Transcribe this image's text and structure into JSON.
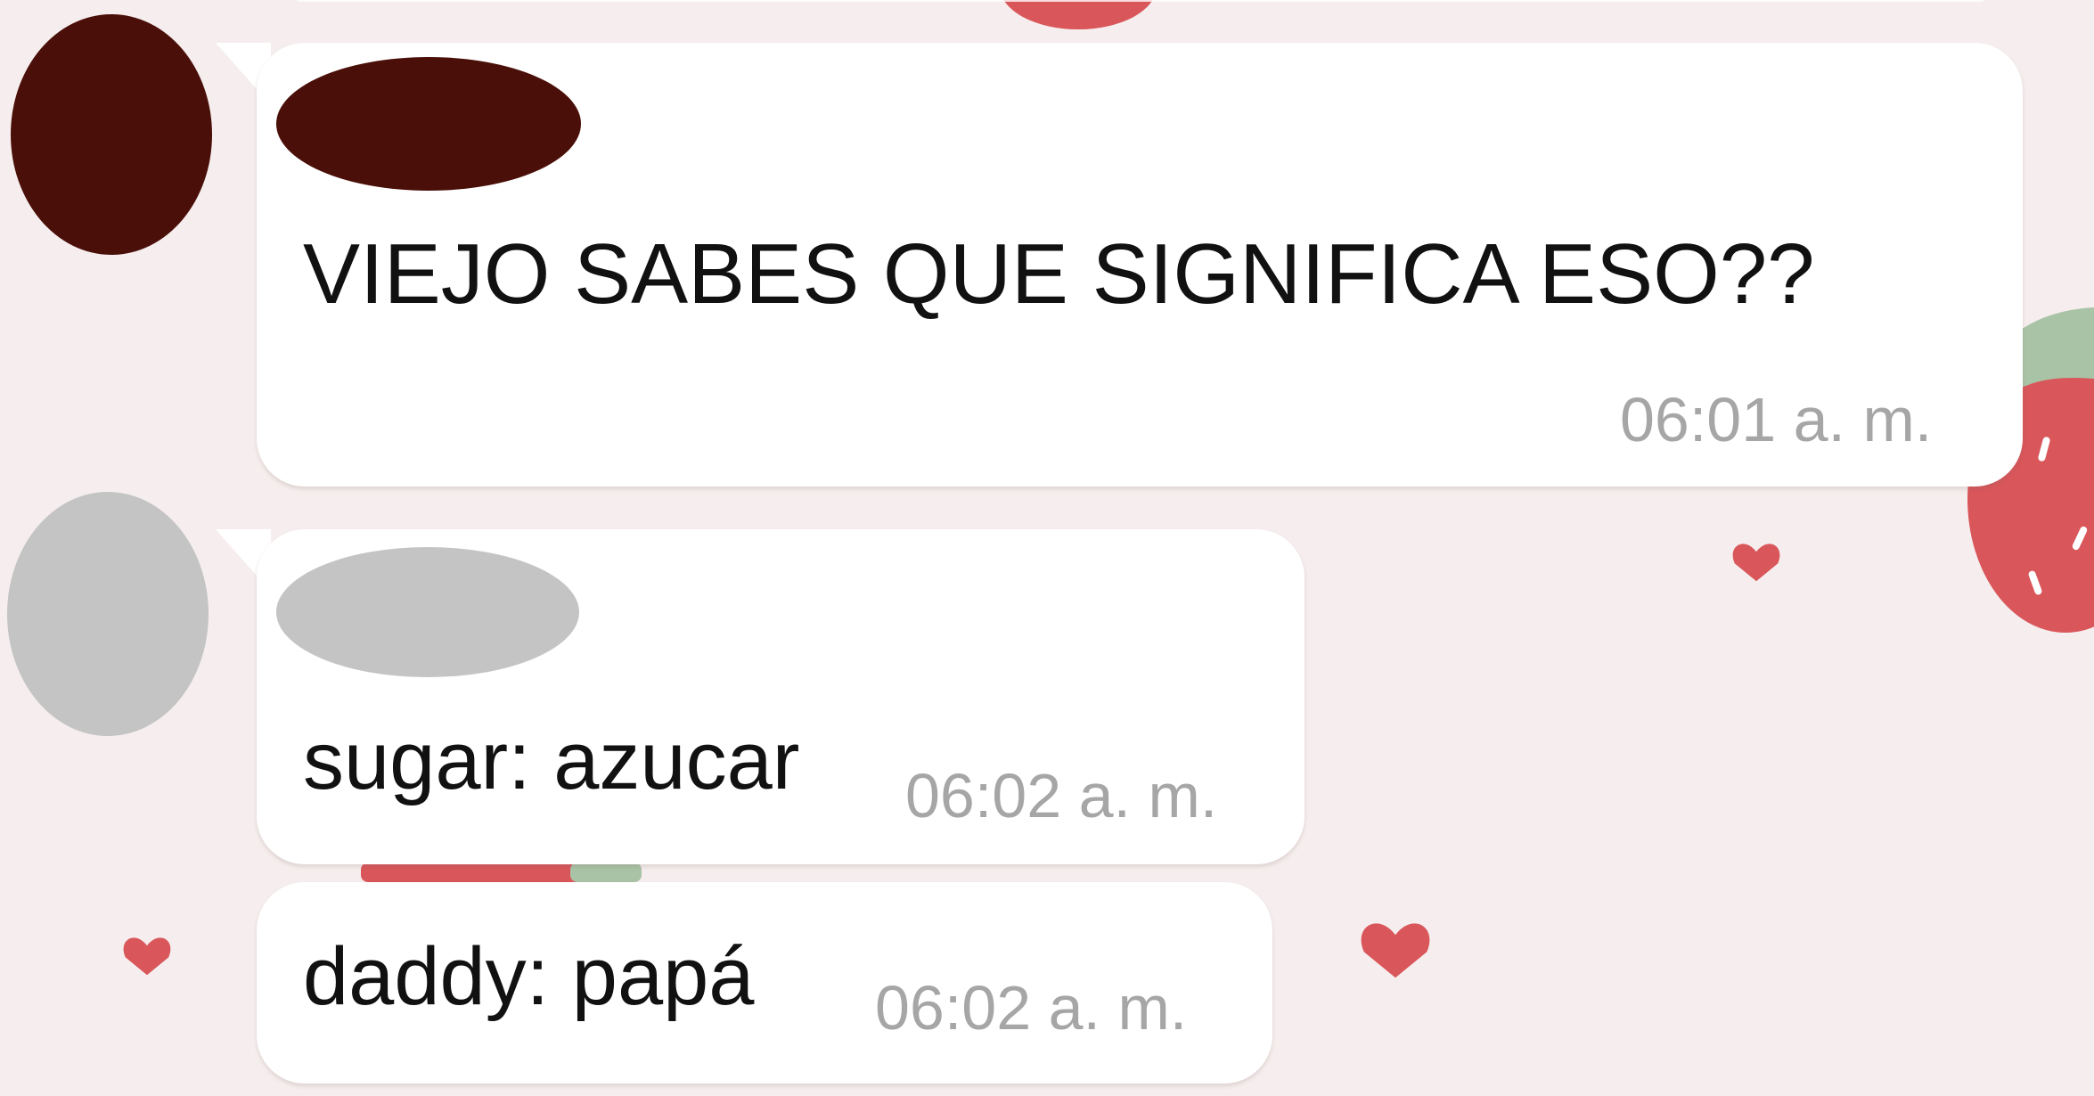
{
  "colors": {
    "background": "#f6eeee",
    "bubble": "#ffffff",
    "sender_primary": "#4a0f08",
    "sender_secondary": "#c4c4c4",
    "timestamp": "#a6a6a6",
    "text": "#111111",
    "decor_red": "#d9575b",
    "decor_green": "#a9c3a6"
  },
  "messages": [
    {
      "sender": "redacted-dark",
      "text": "VIEJO SABES QUE SIGNIFICA ESO??",
      "time": "06:01 a. m."
    },
    {
      "sender": "redacted-gray",
      "text": "sugar: azucar",
      "time": "06:02 a. m."
    },
    {
      "sender": "redacted-gray",
      "text": "daddy: papá",
      "time": "06:02 a. m."
    }
  ],
  "decorations": {
    "icon": "heart-icon",
    "strawberry": "strawberry-icon"
  }
}
